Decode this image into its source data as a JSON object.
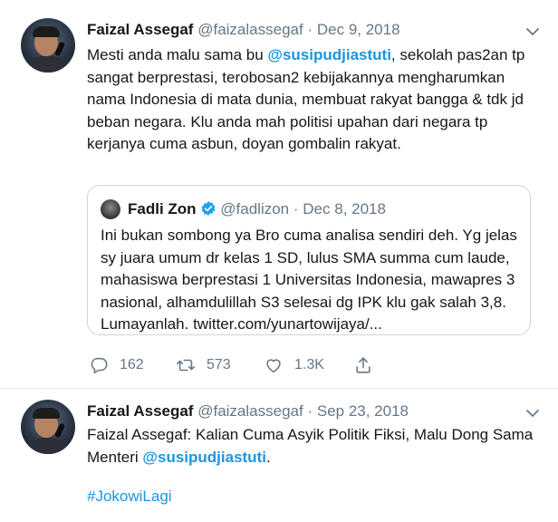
{
  "tweets": [
    {
      "author_name": "Faizal Assegaf",
      "handle": "@faizalassegaf",
      "separator": "·",
      "date": "Dec 9, 2018",
      "text_parts": {
        "p1": "Mesti anda malu sama bu ",
        "mention": "@susipudjiastuti",
        "p2": ", sekolah pas2an tp sangat berprestasi, terobosan2 kebijakannya mengharumkan nama Indonesia di mata dunia, membuat rakyat bangga & tdk jd beban negara. Klu anda mah politisi upahan dari negara tp kerjanya cuma asbun, doyan gombalin rakyat."
      },
      "quoted": {
        "author_name": "Fadli Zon",
        "handle": "@fadlizon",
        "separator": "·",
        "date": "Dec 8, 2018",
        "text": "Ini bukan sombong ya Bro cuma analisa sendiri deh. Yg jelas sy juara umum dr kelas 1 SD, lulus SMA summa cum laude, mahasiswa berprestasi 1 Universitas Indonesia, mawapres 3 nasional, alhamdulillah S3 selesai dg IPK klu gak salah 3,8. Lumayanlah. twitter.com/yunartowijaya/..."
      },
      "actions": {
        "replies": "162",
        "retweets": "573",
        "likes": "1.3K"
      }
    },
    {
      "author_name": "Faizal Assegaf",
      "handle": "@faizalassegaf",
      "separator": "·",
      "date": "Sep 23, 2018",
      "text_parts": {
        "p1": "Faizal Assegaf: Kalian Cuma Asyik Politik Fiksi, Malu Dong Sama Menteri ",
        "mention": "@susipudjiastuti",
        "p2": ".",
        "hashtag": "#JokowiLagi"
      }
    }
  ],
  "colors": {
    "link": "#1b95e0",
    "muted": "#657786",
    "border": "#e6ecf0"
  },
  "icons": [
    "reply-icon",
    "retweet-icon",
    "like-icon",
    "share-icon",
    "chevron-down-icon",
    "verified-badge-icon"
  ]
}
